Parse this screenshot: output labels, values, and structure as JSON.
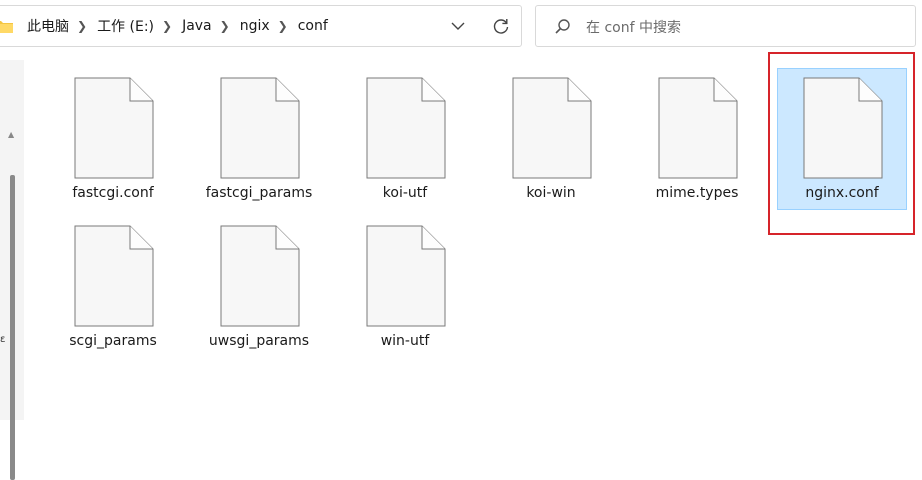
{
  "breadcrumb": {
    "items": [
      "此电脑",
      "工作 (E:)",
      "Java",
      "ngix",
      "conf"
    ]
  },
  "search": {
    "placeholder": "在 conf 中搜索"
  },
  "files": [
    {
      "name": "fastcgi.conf",
      "selected": false
    },
    {
      "name": "fastcgi_params",
      "selected": false
    },
    {
      "name": "koi-utf",
      "selected": false
    },
    {
      "name": "koi-win",
      "selected": false
    },
    {
      "name": "mime.types",
      "selected": false
    },
    {
      "name": "nginx.conf",
      "selected": true
    },
    {
      "name": "scgi_params",
      "selected": false
    },
    {
      "name": "uwsgi_params",
      "selected": false
    },
    {
      "name": "win-utf",
      "selected": false
    }
  ],
  "nav_pane": {
    "edge_glyph": "ε"
  },
  "colors": {
    "selection_fill": "#cce8ff",
    "selection_border": "#99d1ff",
    "annotation_red": "#d6242a",
    "folder_yellow": "#f4c542"
  },
  "icons": {
    "breadcrumb_folder": "folder-icon",
    "address_dropdown": "chevron-down-icon",
    "refresh": "refresh-icon",
    "search": "search-icon",
    "file": "document-icon"
  }
}
